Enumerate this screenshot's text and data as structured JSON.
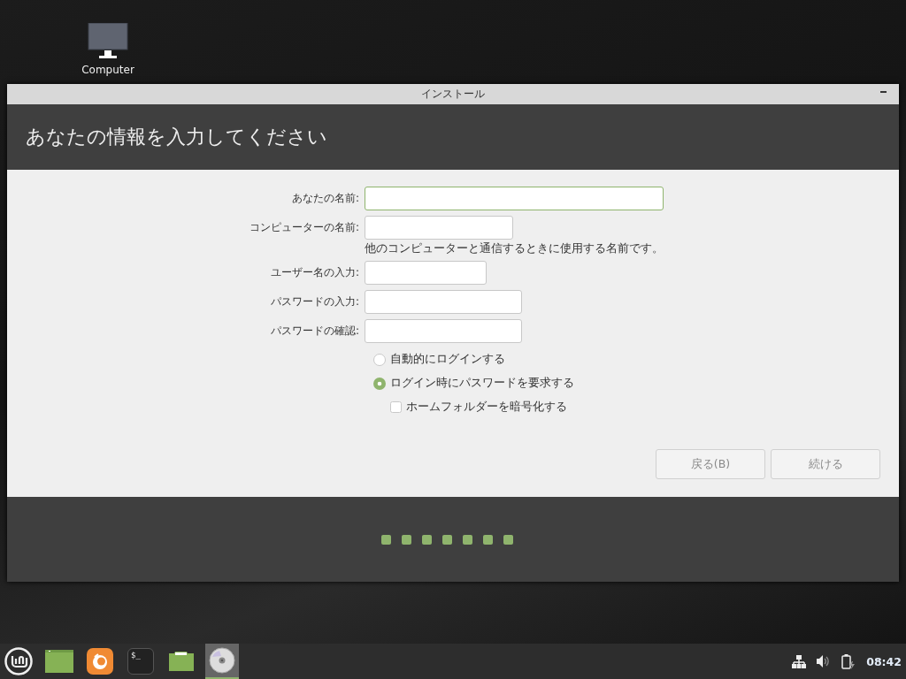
{
  "desktop_icons": [
    {
      "label": "Computer"
    }
  ],
  "window": {
    "title": "インストール",
    "heading": "あなたの情報を入力してください"
  },
  "form": {
    "fields": [
      {
        "label": "あなたの名前:",
        "focused": true
      },
      {
        "label": "コンピューターの名前:",
        "focused": false,
        "hint": "他のコンピューターと通信するときに使用する名前です。"
      },
      {
        "label": "ユーザー名の入力:",
        "focused": false
      },
      {
        "label": "パスワードの入力:",
        "focused": false
      },
      {
        "label": "パスワードの確認:",
        "focused": false
      }
    ],
    "login_options": [
      {
        "label": "自動的にログインする",
        "selected": false
      },
      {
        "label": "ログイン時にパスワードを要求する",
        "selected": true
      }
    ],
    "encrypt_home": {
      "label": "ホームフォルダーを暗号化する",
      "checked": false
    }
  },
  "buttons": [
    {
      "label": "戻る(B)",
      "disabled": true
    },
    {
      "label": "続ける",
      "disabled": true
    }
  ],
  "progress_steps": [
    {
      "kind": "step"
    },
    {
      "kind": "step"
    },
    {
      "kind": "step"
    },
    {
      "kind": "step"
    },
    {
      "kind": "step"
    },
    {
      "kind": "step"
    },
    {
      "kind": "step"
    }
  ],
  "taskbar": {
    "launchers": [
      {
        "kind": "menu",
        "selected": false
      },
      {
        "kind": "desktop",
        "selected": false
      },
      {
        "kind": "browser",
        "selected": false
      },
      {
        "kind": "terminal",
        "selected": false,
        "text": "$_"
      },
      {
        "kind": "folder",
        "selected": false
      },
      {
        "kind": "disc",
        "selected": true
      }
    ],
    "tray": {
      "clock": "08:42"
    }
  }
}
